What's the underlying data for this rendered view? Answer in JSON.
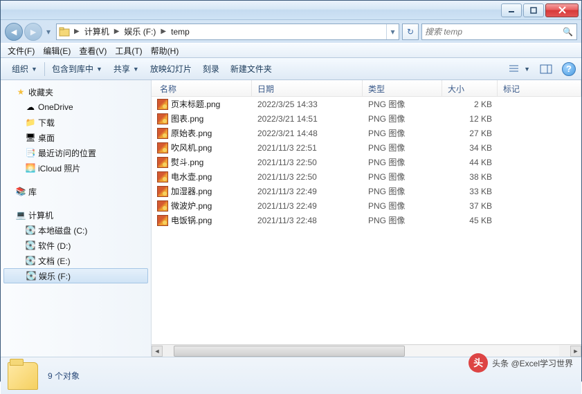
{
  "breadcrumb": [
    "计算机",
    "娱乐 (F:)",
    "temp"
  ],
  "search": {
    "placeholder": "搜索 temp"
  },
  "menus": {
    "file": "文件(F)",
    "edit": "编辑(E)",
    "view": "查看(V)",
    "tools": "工具(T)",
    "help": "帮助(H)"
  },
  "toolbar": {
    "organize": "组织",
    "include": "包含到库中",
    "share": "共享",
    "slideshow": "放映幻灯片",
    "burn": "刻录",
    "newfolder": "新建文件夹"
  },
  "columns": {
    "name": "名称",
    "date": "日期",
    "type": "类型",
    "size": "大小",
    "mark": "标记"
  },
  "sidebar": {
    "favorites": {
      "label": "收藏夹",
      "items": [
        {
          "id": "onedrive",
          "label": "OneDrive"
        },
        {
          "id": "downloads",
          "label": "下载"
        },
        {
          "id": "desktop",
          "label": "桌面"
        },
        {
          "id": "recent",
          "label": "最近访问的位置"
        },
        {
          "id": "icloud",
          "label": "iCloud 照片"
        }
      ]
    },
    "libraries": {
      "label": "库"
    },
    "computer": {
      "label": "计算机",
      "items": [
        {
          "id": "drc",
          "label": "本地磁盘 (C:)"
        },
        {
          "id": "drd",
          "label": "软件 (D:)"
        },
        {
          "id": "dre",
          "label": "文档 (E:)"
        },
        {
          "id": "drf",
          "label": "娱乐 (F:)",
          "selected": true
        }
      ]
    }
  },
  "files": [
    {
      "name": "页末标题.png",
      "date": "2022/3/25 14:33",
      "type": "PNG 图像",
      "size": "2 KB"
    },
    {
      "name": "图表.png",
      "date": "2022/3/21 14:51",
      "type": "PNG 图像",
      "size": "12 KB"
    },
    {
      "name": "原始表.png",
      "date": "2022/3/21 14:48",
      "type": "PNG 图像",
      "size": "27 KB"
    },
    {
      "name": "吹风机.png",
      "date": "2021/11/3 22:51",
      "type": "PNG 图像",
      "size": "34 KB"
    },
    {
      "name": "熨斗.png",
      "date": "2021/11/3 22:50",
      "type": "PNG 图像",
      "size": "44 KB"
    },
    {
      "name": "电水壶.png",
      "date": "2021/11/3 22:50",
      "type": "PNG 图像",
      "size": "38 KB"
    },
    {
      "name": "加湿器.png",
      "date": "2021/11/3 22:49",
      "type": "PNG 图像",
      "size": "33 KB"
    },
    {
      "name": "微波炉.png",
      "date": "2021/11/3 22:49",
      "type": "PNG 图像",
      "size": "37 KB"
    },
    {
      "name": "电饭锅.png",
      "date": "2021/11/3 22:48",
      "type": "PNG 图像",
      "size": "45 KB"
    }
  ],
  "status": {
    "count": "9 个对象"
  },
  "watermark": "头条 @Excel学习世界"
}
